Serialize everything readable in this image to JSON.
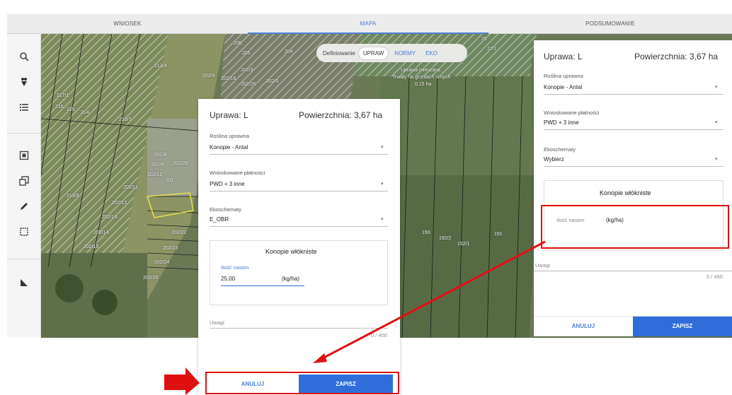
{
  "tabs": [
    {
      "label": "WNIOSEK"
    },
    {
      "label": "MAPA"
    },
    {
      "label": "PODSUMOWANIE"
    }
  ],
  "toolbar": {
    "tools": [
      "search-icon",
      "layers-icon",
      "list-icon",
      "target-icon",
      "copy-icon",
      "pencil-icon",
      "select-icon",
      "measure-icon"
    ]
  },
  "map_toggle": {
    "label": "Definiowanie",
    "options": [
      "UPRAW",
      "NORMY",
      "EKO"
    ],
    "selected": "UPRAW"
  },
  "map_labels": {
    "l1": "206",
    "l2": "205",
    "l3": "204",
    "l4": "213/4",
    "l5": "202/4",
    "l6": "202/16",
    "l7": "202/3",
    "l8": "202/5",
    "l9": "202/26",
    "l10": "217/1",
    "l11": "216",
    "l12": "215",
    "l13": "214",
    "l14": "213/7",
    "l15": "202/8",
    "l16": "202/9",
    "l17": "202/20",
    "l18": "202/12",
    "l19": "201",
    "l20": "202/11",
    "l21": "213/9",
    "l22": "202/12",
    "l23": "202/13",
    "l24": "202/14",
    "l25": "202/15",
    "l26": "202/22",
    "l27": "202/23",
    "l28": "202/24",
    "l29": "202/25",
    "l30": "193",
    "l31": "192/2",
    "l32": "152/1",
    "l33": "191",
    "l34": "27/1",
    "l35": "25",
    "l36": "Trwaly na gruntach ornych",
    "l37": "0,15 ha",
    "l38": "Uprawa mieszana"
  },
  "form_main": {
    "title": "Uprawa: L",
    "area": "Powierzchnia: 3,67 ha",
    "plant_label": "Roślina uprawna",
    "plant_value": "Konopie - Antal",
    "payments_label": "Wnioskowane płatności",
    "payments_value": "PWD + 3 inne",
    "eco_label": "Ekoschematy",
    "eco_value": "E_OBR",
    "hemp_title": "Konopie włókniste",
    "seeds_label": "Ilość nasion",
    "seeds_value": "25,00",
    "seeds_unit": "(kg/ha)",
    "notes_label": "Uwagi",
    "notes_count": "0 / 450",
    "cancel": "ANULUJ",
    "save": "ZAPISZ"
  },
  "form_side": {
    "title": "Uprawa: L",
    "area": "Powierzchnia: 3,67 ha",
    "plant_label": "Roślina uprawna",
    "plant_value": "Konopie - Antal",
    "payments_label": "Wnioskowane płatności",
    "payments_value": "PWD + 3 inne",
    "eco_label": "Ekoschematy",
    "eco_value": "Wybierz",
    "hemp_title": "Konopie włókniste",
    "seeds_label": "Ilość nasion",
    "seeds_unit": "(kg/ha)",
    "notes_label": "Uwagi",
    "notes_count": "0 / 450",
    "cancel": "ANULUJ",
    "save": "ZAPISZ"
  },
  "colors": {
    "accent": "#2f6ed8",
    "annotation": "#e01010",
    "tab_active": "#4a7fd4"
  }
}
